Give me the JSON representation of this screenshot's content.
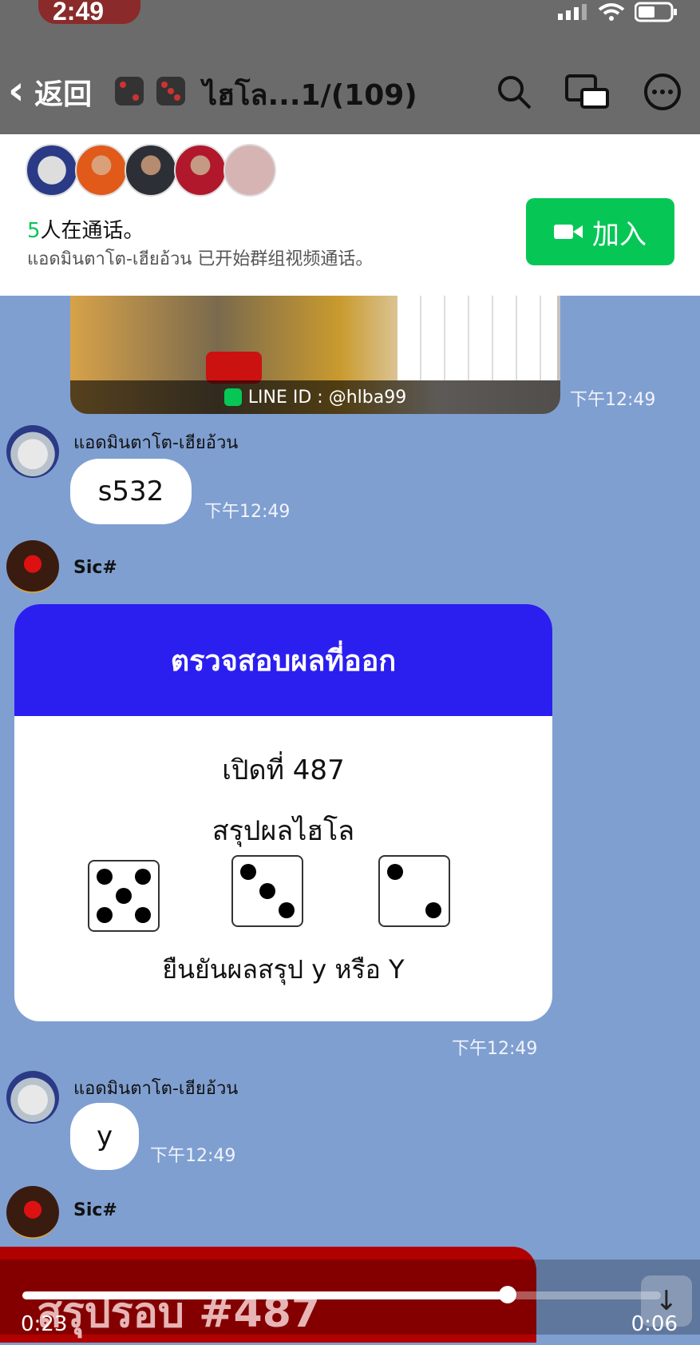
{
  "status": {
    "time": "2:49"
  },
  "nav": {
    "back_label": "返回",
    "title": "ไฮโล...1/(109)"
  },
  "call": {
    "count": "5",
    "count_suffix": "人在通话。",
    "subtitle": "แอดมินตาโต-เฮียอ้วน 已开始群组视频通话。",
    "join_label": "加入"
  },
  "image_msg": {
    "line_id": "LINE ID : @hlba99",
    "time": "下午12:49"
  },
  "messages": [
    {
      "sender": "แอดมินตาโต-เฮียอ้วน",
      "text": "s532",
      "time": "下午12:49"
    },
    {
      "sender": "Sic#"
    },
    {
      "sender": "แอดมินตาโต-เฮียอ้วน",
      "text": "y",
      "time": "下午12:49"
    },
    {
      "sender": "Sic#"
    }
  ],
  "card": {
    "header": "ตรวจสอบผลที่ออก",
    "line1": "เปิดที่ 487",
    "line2": "สรุปผลไฮโล",
    "dice": [
      5,
      3,
      2
    ],
    "confirm": "ยืนยันผลสรุป y หรือ Y",
    "time": "下午12:49"
  },
  "bottom": {
    "red_card_text": "สรุปรอบ #487",
    "elapsed": "0:23",
    "remaining": "0:06",
    "progress": 0.76
  }
}
